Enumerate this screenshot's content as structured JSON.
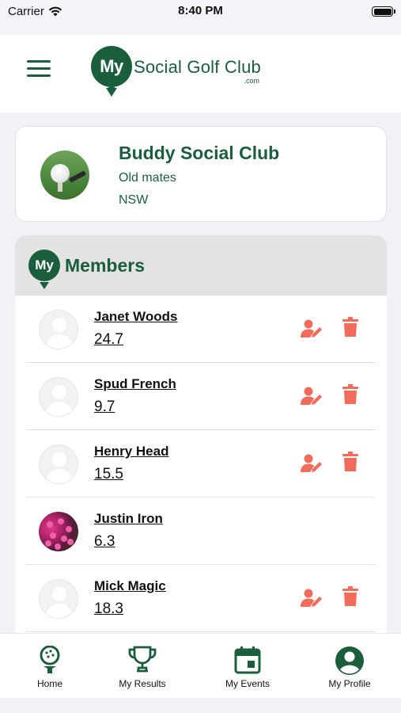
{
  "status_bar": {
    "carrier": "Carrier",
    "time": "8:40 PM"
  },
  "header": {
    "logo_badge": "My",
    "logo_name": "Social Golf Club",
    "logo_suffix": ".com"
  },
  "club": {
    "name": "Buddy Social Club",
    "description": "Old mates",
    "state": "NSW"
  },
  "members_section": {
    "badge": "My",
    "title": "Members",
    "members": [
      {
        "name": "Janet Woods",
        "handicap": "24.7",
        "avatar": "placeholder",
        "can_edit": true
      },
      {
        "name": "Spud French",
        "handicap": "9.7",
        "avatar": "placeholder",
        "can_edit": true
      },
      {
        "name": "Henry Head",
        "handicap": "15.5",
        "avatar": "placeholder",
        "can_edit": true
      },
      {
        "name": "Justin Iron",
        "handicap": "6.3",
        "avatar": "photo",
        "can_edit": false
      },
      {
        "name": "Mick Magic",
        "handicap": "18.3",
        "avatar": "placeholder",
        "can_edit": true
      }
    ]
  },
  "tab_bar": {
    "tabs": [
      {
        "label": "Home",
        "icon": "golf-ball-tee-icon"
      },
      {
        "label": "My Results",
        "icon": "trophy-icon"
      },
      {
        "label": "My Events",
        "icon": "calendar-icon"
      },
      {
        "label": "My Profile",
        "icon": "account-circle-icon"
      }
    ]
  },
  "colors": {
    "brand_green": "#1b5e3e",
    "action_red": "#f26b5b",
    "background": "#f1f1f6"
  }
}
